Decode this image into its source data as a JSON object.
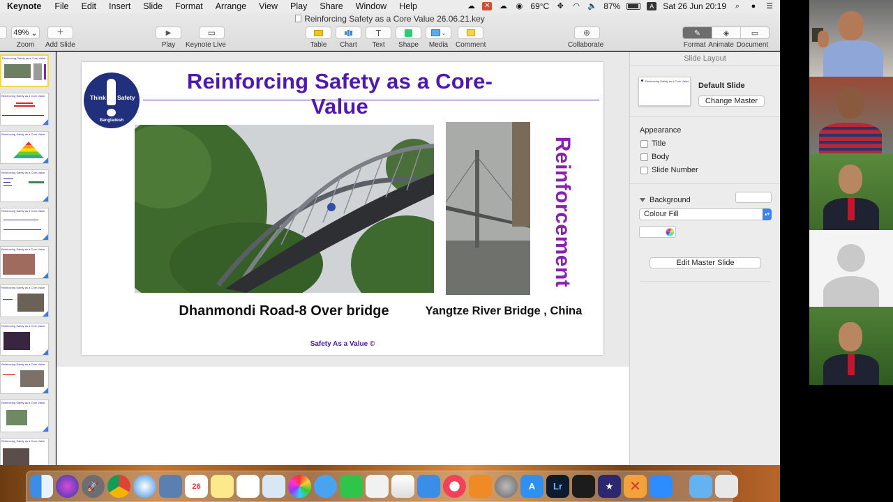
{
  "menubar": {
    "app_name": "Keynote",
    "items": [
      "File",
      "Edit",
      "Insert",
      "Slide",
      "Format",
      "Arrange",
      "View",
      "Play",
      "Share",
      "Window",
      "Help"
    ],
    "temperature": "69°C",
    "battery": "87%",
    "input_source": "A",
    "datetime": "Sat 26 Jun  20:19"
  },
  "toolbar": {
    "doc_title": "Reinforcing Safety as a Core Value 26.06.21.key",
    "zoom_value": "49%",
    "zoom_label": "Zoom",
    "add_slide_label": "Add Slide",
    "play_label": "Play",
    "keynote_live_label": "Keynote Live",
    "table_label": "Table",
    "chart_label": "Chart",
    "text_label": "Text",
    "text_glyph": "T",
    "shape_label": "Shape",
    "media_label": "Media",
    "comment_label": "Comment",
    "collaborate_label": "Collaborate",
    "format_label": "Format",
    "animate_label": "Animate",
    "document_label": "Document"
  },
  "navigator": {
    "thumb_title": "Reinforcing Safety as a Core-Value"
  },
  "slide": {
    "title": "Reinforcing Safety as a Core-Value",
    "logo_left": "Think",
    "logo_right": "Safety",
    "logo_bottom": "Bangladesh",
    "vertical_text": "Reinforcement",
    "caption_left": "Dhanmondi Road-8 Over bridge",
    "caption_right": "Yangtze River Bridge , China",
    "footer": "Safety As a Value ©"
  },
  "inspector": {
    "header": "Slide Layout",
    "master_thumb_title": "Reinforcing Safety as a Core-Value",
    "master_name": "Default Slide",
    "change_master": "Change Master",
    "appearance_label": "Appearance",
    "checkbox_title": "Title",
    "checkbox_body": "Body",
    "checkbox_slide_number": "Slide Number",
    "background_label": "Background",
    "fill_type": "Colour Fill",
    "edit_master": "Edit Master Slide"
  },
  "colors": {
    "title_purple": "#4f17b3",
    "vertical_text": "#8c1fb3",
    "logo_navy": "#21307c",
    "accent_blue": "#3b82f0"
  }
}
